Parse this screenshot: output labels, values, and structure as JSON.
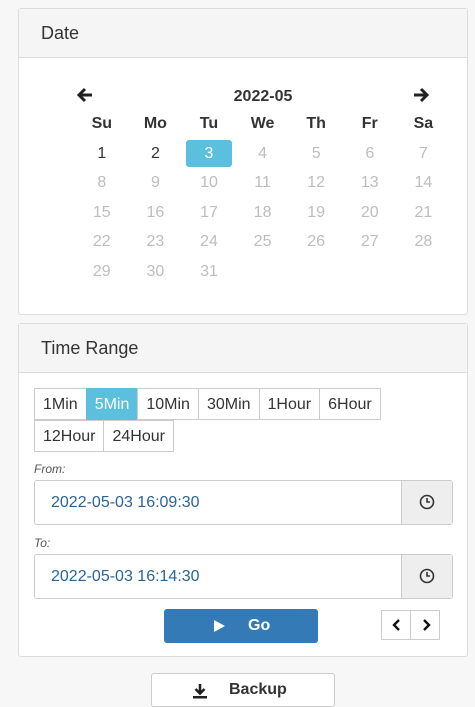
{
  "date_panel": {
    "title": "Date",
    "calendar": {
      "month_label": "2022-05",
      "prev_icon": "arrow-left-icon",
      "next_icon": "arrow-right-icon",
      "weekdays": [
        "Su",
        "Mo",
        "Tu",
        "We",
        "Th",
        "Fr",
        "Sa"
      ],
      "weeks": [
        [
          {
            "d": "1",
            "s": "enabled"
          },
          {
            "d": "2",
            "s": "enabled"
          },
          {
            "d": "3",
            "s": "selected"
          },
          {
            "d": "4",
            "s": "disabled"
          },
          {
            "d": "5",
            "s": "disabled"
          },
          {
            "d": "6",
            "s": "disabled"
          },
          {
            "d": "7",
            "s": "disabled"
          }
        ],
        [
          {
            "d": "8",
            "s": "disabled"
          },
          {
            "d": "9",
            "s": "disabled"
          },
          {
            "d": "10",
            "s": "disabled"
          },
          {
            "d": "11",
            "s": "disabled"
          },
          {
            "d": "12",
            "s": "disabled"
          },
          {
            "d": "13",
            "s": "disabled"
          },
          {
            "d": "14",
            "s": "disabled"
          }
        ],
        [
          {
            "d": "15",
            "s": "disabled"
          },
          {
            "d": "16",
            "s": "disabled"
          },
          {
            "d": "17",
            "s": "disabled"
          },
          {
            "d": "18",
            "s": "disabled"
          },
          {
            "d": "19",
            "s": "disabled"
          },
          {
            "d": "20",
            "s": "disabled"
          },
          {
            "d": "21",
            "s": "disabled"
          }
        ],
        [
          {
            "d": "22",
            "s": "disabled"
          },
          {
            "d": "23",
            "s": "disabled"
          },
          {
            "d": "24",
            "s": "disabled"
          },
          {
            "d": "25",
            "s": "disabled"
          },
          {
            "d": "26",
            "s": "disabled"
          },
          {
            "d": "27",
            "s": "disabled"
          },
          {
            "d": "28",
            "s": "disabled"
          }
        ],
        [
          {
            "d": "29",
            "s": "disabled"
          },
          {
            "d": "30",
            "s": "disabled"
          },
          {
            "d": "31",
            "s": "disabled"
          },
          {
            "d": "",
            "s": "empty"
          },
          {
            "d": "",
            "s": "empty"
          },
          {
            "d": "",
            "s": "empty"
          },
          {
            "d": "",
            "s": "empty"
          }
        ]
      ]
    }
  },
  "time_panel": {
    "title": "Time Range",
    "range_rows": [
      [
        {
          "label": "1Min",
          "active": false
        },
        {
          "label": "5Min",
          "active": true
        },
        {
          "label": "10Min",
          "active": false
        },
        {
          "label": "30Min",
          "active": false
        },
        {
          "label": "1Hour",
          "active": false
        },
        {
          "label": "6Hour",
          "active": false
        }
      ],
      [
        {
          "label": "12Hour",
          "active": false
        },
        {
          "label": "24Hour",
          "active": false
        }
      ]
    ],
    "from_label": "From:",
    "from_value": "2022-05-03 16:09:30",
    "to_label": "To:",
    "to_value": "2022-05-03 16:14:30",
    "clock_icon": "clock-icon",
    "go_label": "Go",
    "go_icon": "play-icon",
    "prev_icon": "chevron-left-icon",
    "next_icon": "chevron-right-icon"
  },
  "backup": {
    "label": "Backup",
    "icon": "download-icon"
  },
  "colors": {
    "accent_selected": "#5bc0de",
    "primary_button": "#337ab7",
    "datetime_text": "#2a6496"
  }
}
